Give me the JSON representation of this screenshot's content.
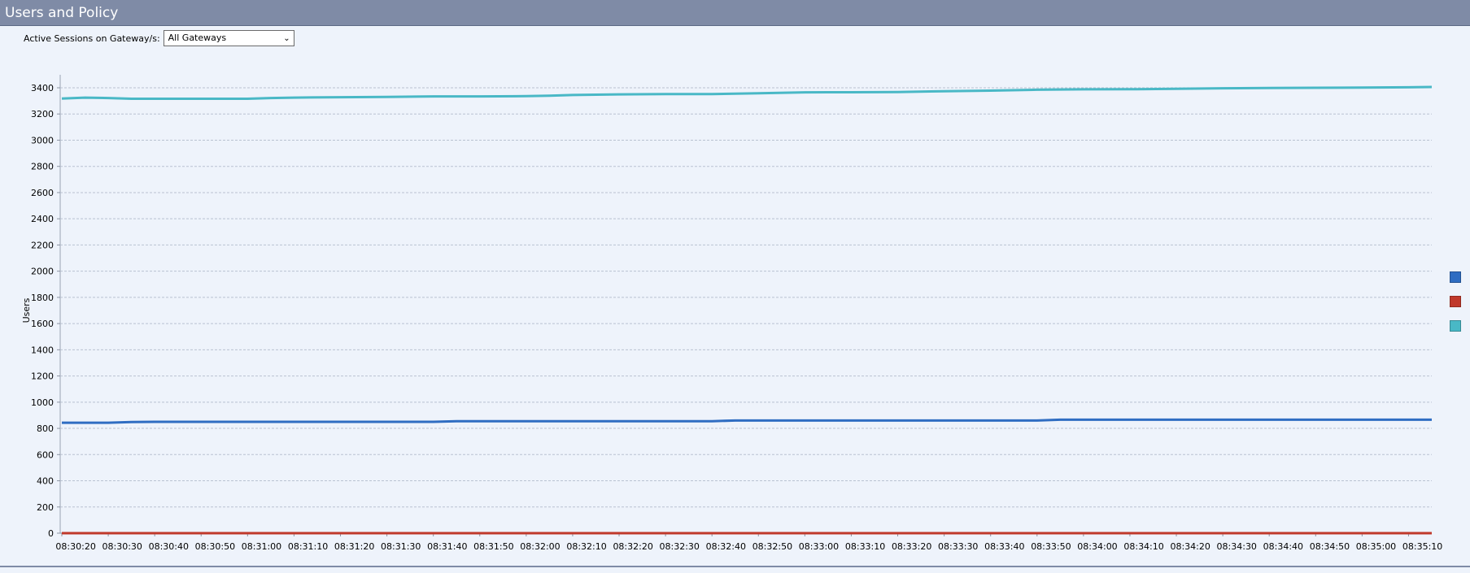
{
  "header": {
    "title": "Users and Policy"
  },
  "filter": {
    "label": "Active Sessions on Gateway/s:",
    "selected": "All Gateways"
  },
  "colors": {
    "series_blue": "#2f6dc2",
    "series_orange": "#c0392b",
    "series_teal": "#49b8c6"
  },
  "chart_data": {
    "type": "line",
    "ylabel": "Users",
    "ylim": [
      0,
      3500
    ],
    "yticks": [
      0,
      200,
      400,
      600,
      800,
      1000,
      1200,
      1400,
      1600,
      1800,
      2000,
      2200,
      2400,
      2600,
      2800,
      3000,
      3200,
      3400
    ],
    "xticks": [
      "08:30:20",
      "08:30:30",
      "08:30:40",
      "08:30:50",
      "08:31:00",
      "08:31:10",
      "08:31:20",
      "08:31:30",
      "08:31:40",
      "08:31:50",
      "08:32:00",
      "08:32:10",
      "08:32:20",
      "08:32:30",
      "08:32:40",
      "08:32:50",
      "08:33:00",
      "08:33:10",
      "08:33:20",
      "08:33:30",
      "08:33:40",
      "08:33:50",
      "08:34:00",
      "08:34:10",
      "08:34:20",
      "08:34:30",
      "08:34:40",
      "08:34:50",
      "08:35:00",
      "08:35:10"
    ],
    "grid": true,
    "legend": "right",
    "series": [
      {
        "color": "#49b8c6",
        "x": [
          "08:30:20",
          "08:30:25",
          "08:30:30",
          "08:30:35",
          "08:30:40",
          "08:30:50",
          "08:31:00",
          "08:31:05",
          "08:31:10",
          "08:31:20",
          "08:31:30",
          "08:31:40",
          "08:31:50",
          "08:32:00",
          "08:32:05",
          "08:32:10",
          "08:32:20",
          "08:32:30",
          "08:32:40",
          "08:32:50",
          "08:33:00",
          "08:33:10",
          "08:33:20",
          "08:33:30",
          "08:33:40",
          "08:33:50",
          "08:34:00",
          "08:34:10",
          "08:34:20",
          "08:34:30",
          "08:34:40",
          "08:34:50",
          "08:35:00",
          "08:35:10",
          "08:35:15"
        ],
        "values": [
          3318,
          3325,
          3322,
          3316,
          3316,
          3316,
          3316,
          3322,
          3325,
          3328,
          3330,
          3334,
          3334,
          3336,
          3340,
          3345,
          3350,
          3352,
          3352,
          3358,
          3365,
          3366,
          3367,
          3374,
          3378,
          3385,
          3388,
          3389,
          3392,
          3396,
          3398,
          3400,
          3402,
          3404,
          3406
        ]
      },
      {
        "color": "#2f6dc2",
        "x": [
          "08:30:20",
          "08:30:30",
          "08:30:35",
          "08:30:40",
          "08:31:00",
          "08:31:20",
          "08:31:40",
          "08:31:45",
          "08:32:00",
          "08:32:20",
          "08:32:40",
          "08:32:45",
          "08:33:00",
          "08:33:20",
          "08:33:40",
          "08:33:50",
          "08:33:55",
          "08:34:10",
          "08:34:30",
          "08:34:50",
          "08:35:10",
          "08:35:15"
        ],
        "values": [
          843,
          843,
          848,
          850,
          850,
          850,
          850,
          855,
          855,
          855,
          855,
          860,
          860,
          860,
          860,
          860,
          866,
          866,
          866,
          866,
          866,
          866
        ]
      },
      {
        "color": "#c0392b",
        "x": [
          "08:30:20",
          "08:35:15"
        ],
        "values": [
          0,
          0
        ]
      }
    ]
  }
}
